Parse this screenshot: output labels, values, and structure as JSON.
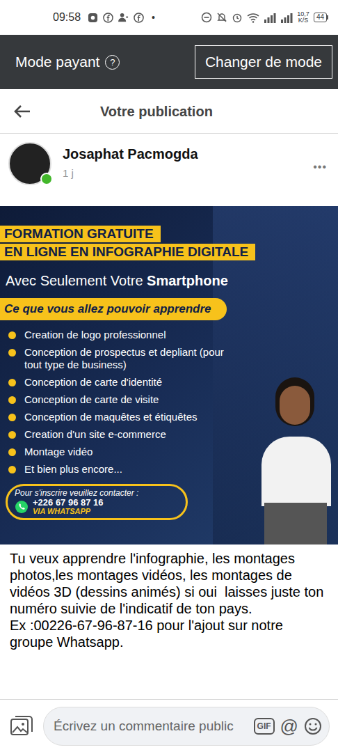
{
  "status_bar": {
    "time": "09:58",
    "dot": "•",
    "speed": "10,7",
    "speed_unit": "K/S",
    "battery": "44"
  },
  "mode_bar": {
    "label": "Mode payant",
    "info": "?",
    "button": "Changer de mode"
  },
  "header": {
    "title": "Votre publication"
  },
  "post": {
    "author": "Josaphat Pacmogda",
    "time": "1 j",
    "online": true,
    "more": "•••",
    "flyer": {
      "title_lines": [
        "FORMATION GRATUITE",
        "EN LIGNE EN INFOGRAPHIE DIGITALE"
      ],
      "subtitle_a": "Avec Seulement Votre ",
      "subtitle_b": "Smartphone",
      "banner": "Ce que vous allez pouvoir apprendre",
      "items": [
        "Creation de logo professionnel",
        "Conception de prospectus et depliant (pour tout type de business)",
        "Conception de carte d'identité",
        "Conception de carte de visite",
        "Conception de maquêtes et étiquêtes",
        "Creation d'un site e-commerce",
        "Montage vidéo",
        "Et bien plus encore..."
      ],
      "contact_label": "Pour s'inscrire veuillez contacter :",
      "phone": "+226 67 96 87 16",
      "via": "VIA WHATSAPP"
    },
    "caption": "Tu veux apprendre l'infographie, les montages photos,les montages vidéos, les montages de vidéos 3D (dessins animés) si oui  laisses juste ton numéro suivie de l'indicatif de ton pays.\nEx :00226-67-96-87-16 pour l'ajout sur notre groupe Whatsapp."
  },
  "comment_bar": {
    "placeholder": "Écrivez un commentaire public",
    "gif": "GIF",
    "at": "@"
  }
}
